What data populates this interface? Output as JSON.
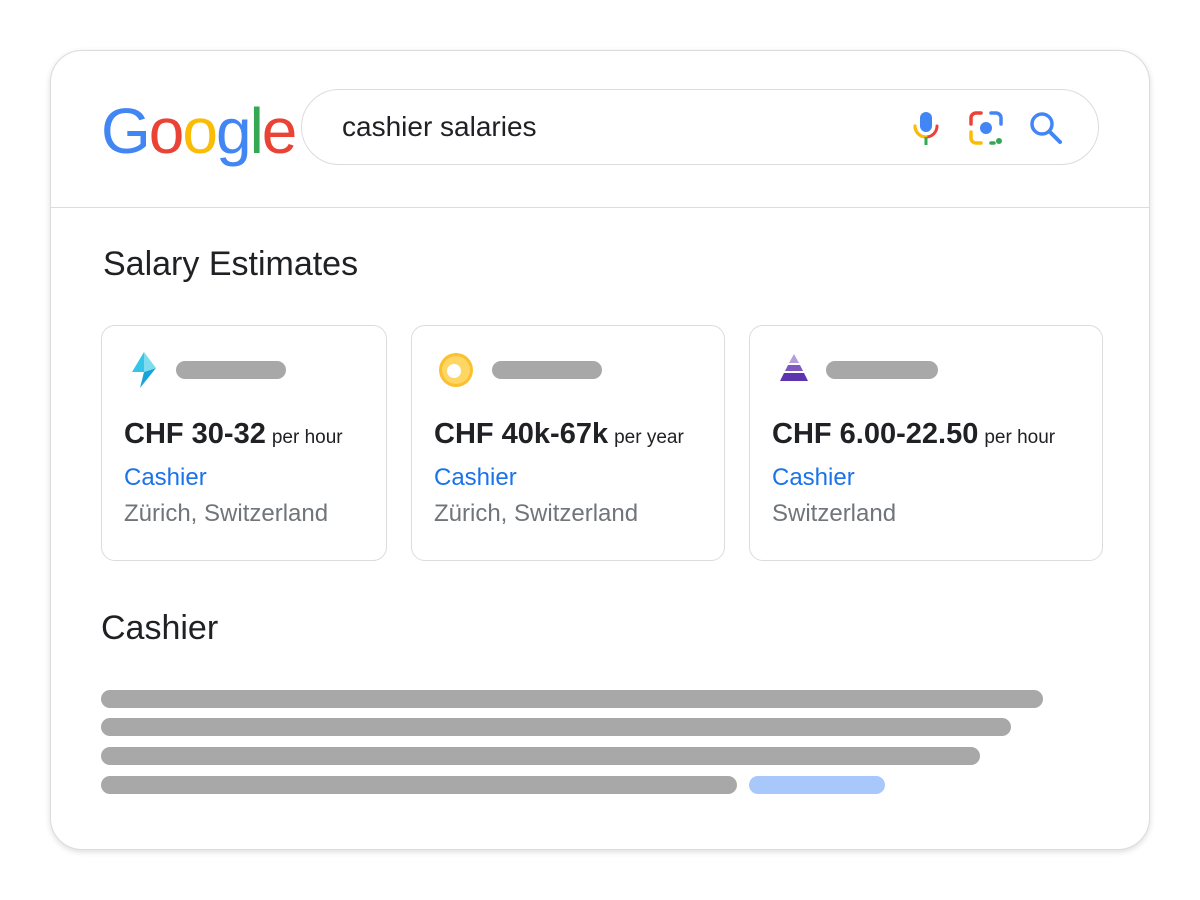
{
  "logo": {
    "letters": [
      "G",
      "o",
      "o",
      "g",
      "l",
      "e"
    ],
    "colors": [
      "#4285f4",
      "#ea4335",
      "#fbbc05",
      "#4285f4",
      "#34a853",
      "#ea4335"
    ]
  },
  "search": {
    "query": "cashier salaries"
  },
  "icons": {
    "mic": "microphone-icon",
    "lens": "camera-lens-icon",
    "search": "search-icon"
  },
  "salary_section": {
    "title": "Salary Estimates",
    "cards": [
      {
        "icon": "lightning-bolt-icon",
        "amount": "CHF 30-32",
        "unit": "per hour",
        "job": "Cashier",
        "location": "Zürich, Switzerland"
      },
      {
        "icon": "ring-logo-icon",
        "amount": "CHF 40k-67k",
        "unit": "per year",
        "job": "Cashier",
        "location": "Zürich, Switzerland"
      },
      {
        "icon": "pyramid-icon",
        "amount": "CHF 6.00-22.50",
        "unit": "per hour",
        "job": "Cashier",
        "location": "Switzerland"
      }
    ]
  },
  "result": {
    "title": "Cashier"
  },
  "colors": {
    "link": "#1a73e8",
    "skeleton": "#a8a8a8",
    "skeleton_link": "#a8c7fa",
    "border": "#dadce0"
  }
}
